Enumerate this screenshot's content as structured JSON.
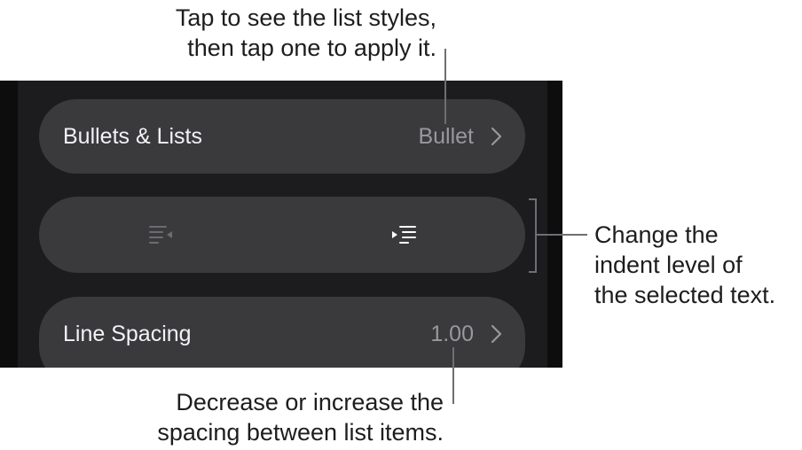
{
  "callouts": {
    "top": [
      "Tap to see the list styles,",
      "then tap one to apply it."
    ],
    "right": [
      "Change the",
      "indent level of",
      "the selected text."
    ],
    "bottom": [
      "Decrease or increase the",
      "spacing between list items."
    ]
  },
  "rows": {
    "bullets": {
      "label": "Bullets & Lists",
      "value": "Bullet"
    },
    "indent": {
      "outdent_icon": "decrease-indent-icon",
      "indent_icon": "increase-indent-icon",
      "outdent_enabled": false,
      "indent_enabled": true
    },
    "spacing": {
      "label": "Line Spacing",
      "value": "1.00"
    }
  },
  "colors": {
    "panel_background": "#1c1c1e",
    "row_background": "#3a3a3c",
    "label_text": "#f2f2f7",
    "value_text": "#98989d",
    "disabled_icon": "#6c6c70",
    "enabled_icon": "#ffffff",
    "leader_line": "#6e6e73"
  }
}
